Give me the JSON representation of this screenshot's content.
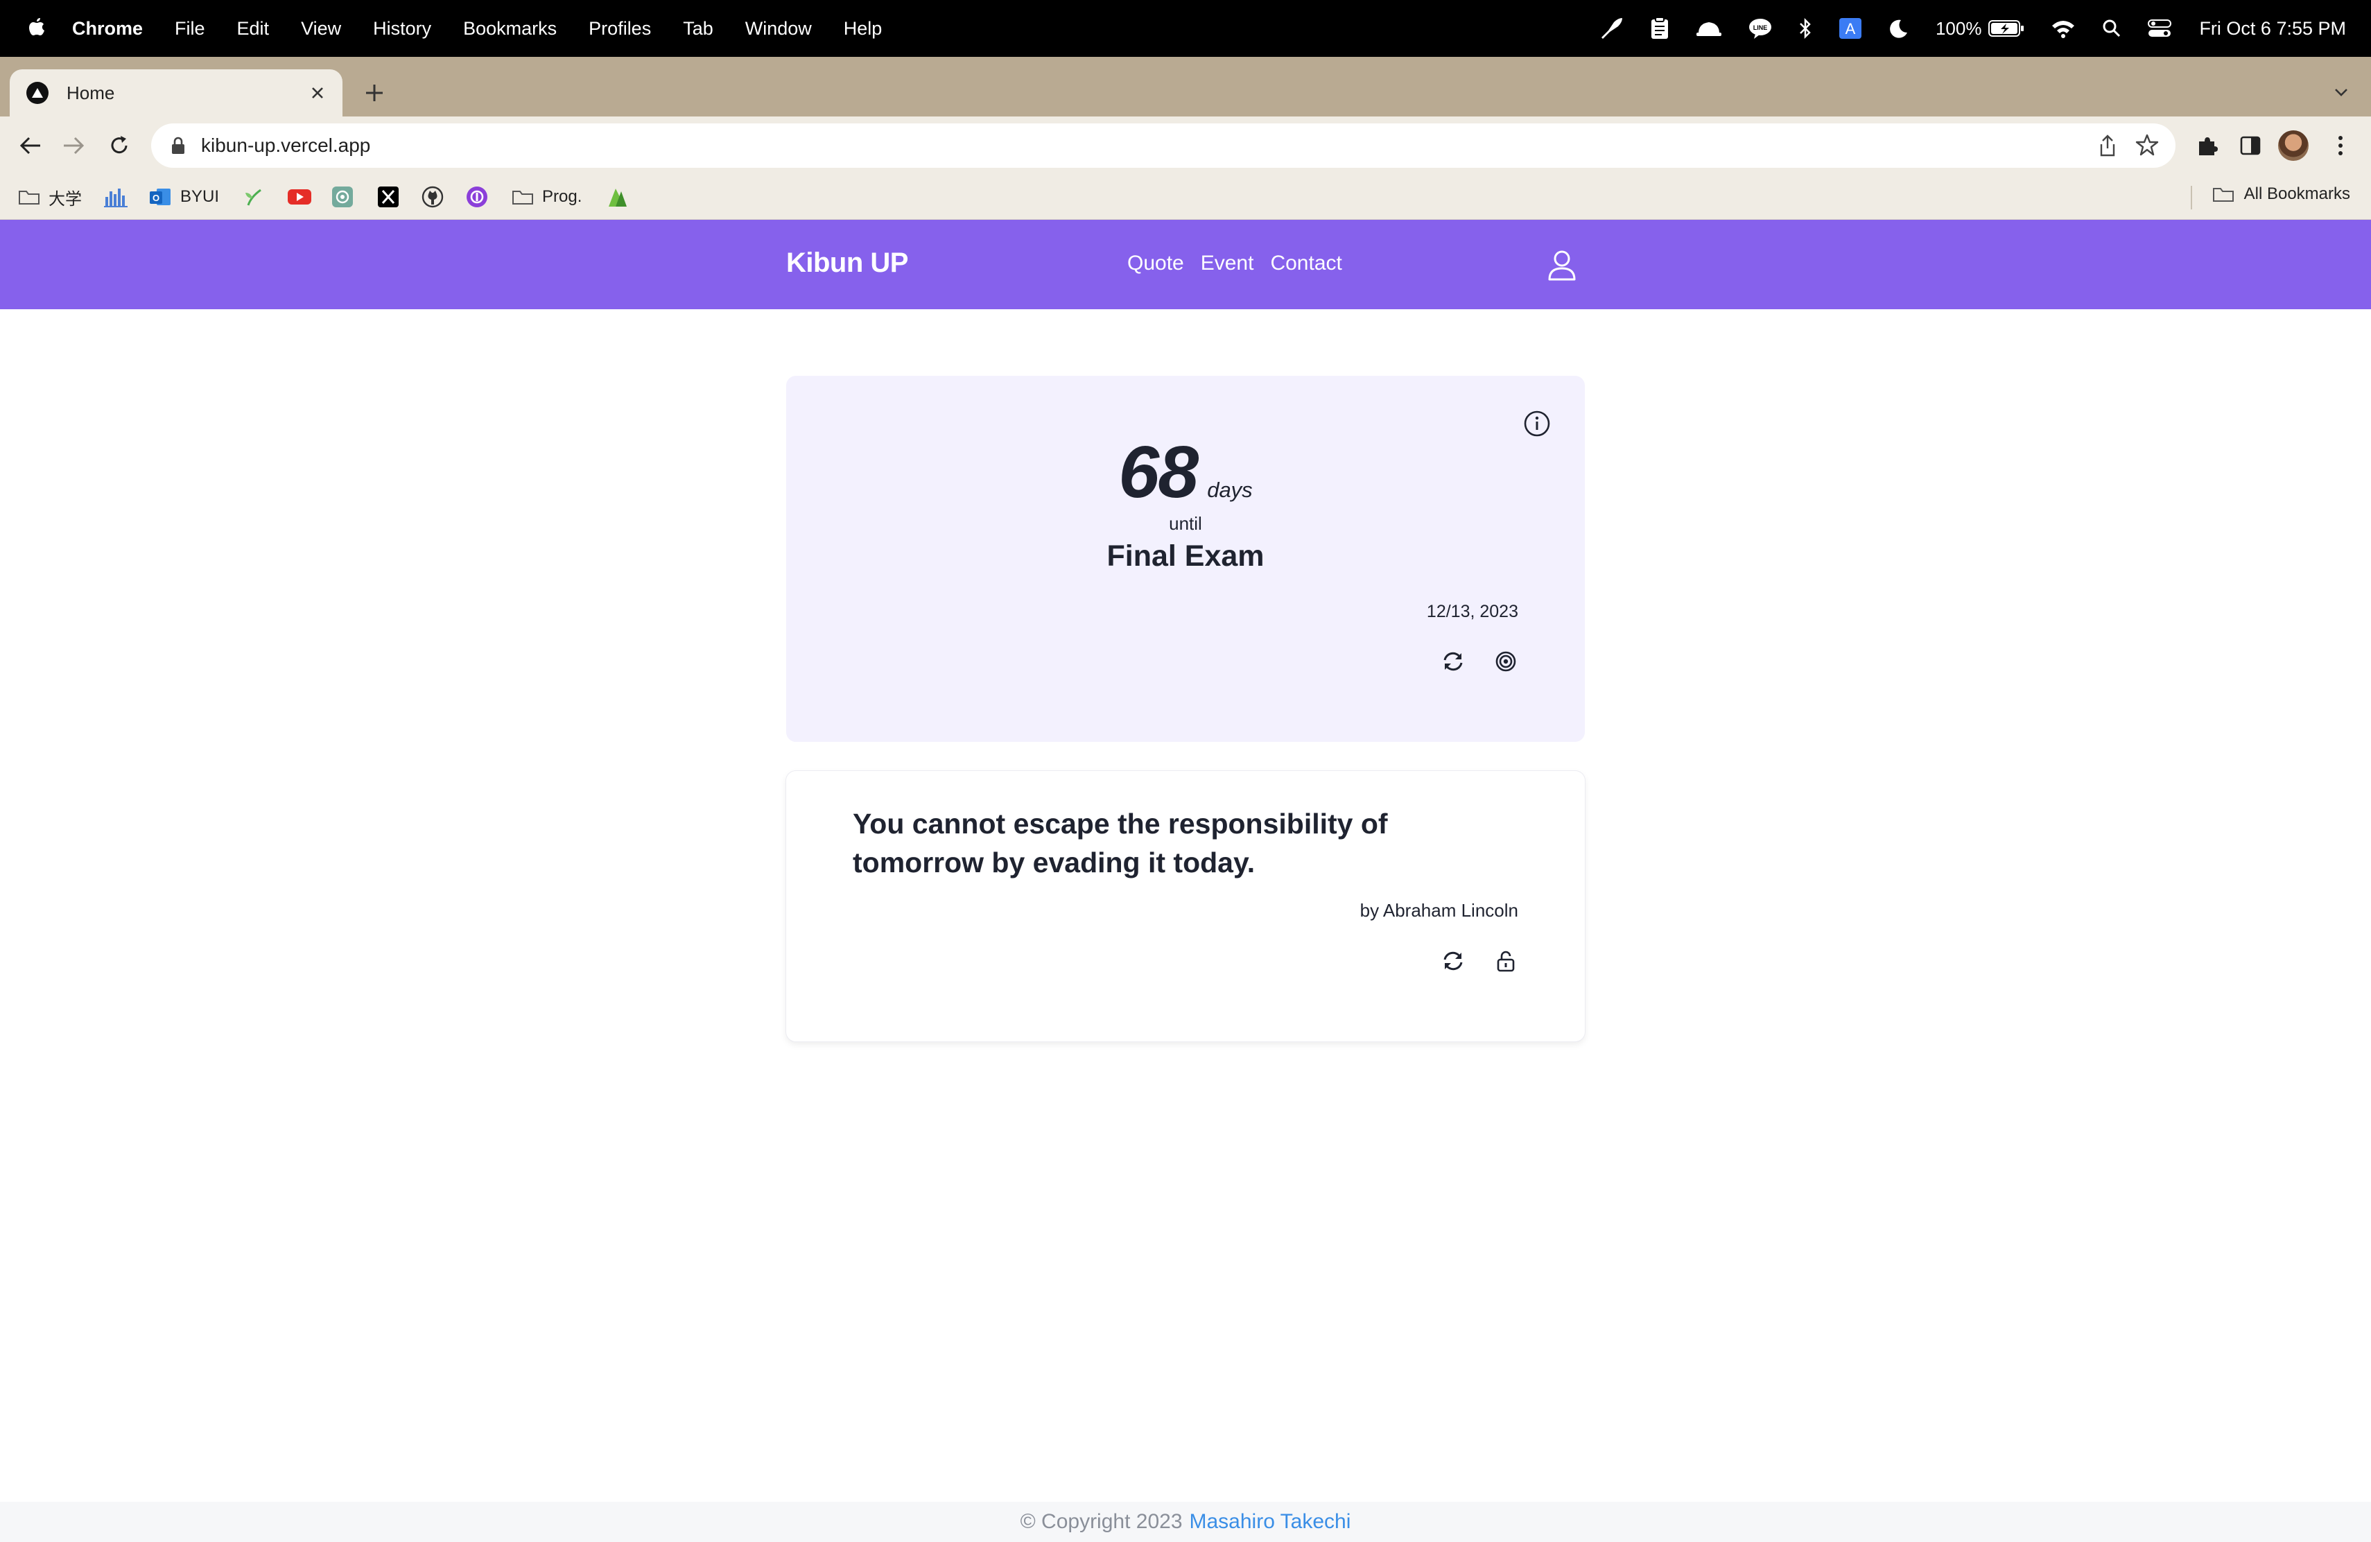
{
  "menubar": {
    "app": "Chrome",
    "items": [
      "File",
      "Edit",
      "View",
      "History",
      "Bookmarks",
      "Profiles",
      "Tab",
      "Window",
      "Help"
    ],
    "battery": "100%",
    "clock": "Fri Oct 6  7:55 PM"
  },
  "browser": {
    "tab_title": "Home",
    "url": "kibun-up.vercel.app",
    "bookmarks": [
      {
        "label": "大学",
        "icon": "folder-icon"
      },
      {
        "label": "",
        "icon": "bar-chart-icon"
      },
      {
        "label": "BYUI",
        "icon": "outlook-icon"
      },
      {
        "label": "",
        "icon": "sprout-icon"
      },
      {
        "label": "",
        "icon": "youtube-icon"
      },
      {
        "label": "",
        "icon": "openai-icon"
      },
      {
        "label": "",
        "icon": "x-icon"
      },
      {
        "label": "",
        "icon": "github-icon"
      },
      {
        "label": "",
        "icon": "purple-circle-icon"
      },
      {
        "label": "Prog.",
        "icon": "folder-icon"
      },
      {
        "label": "",
        "icon": "leaf-icon"
      }
    ],
    "all_bookmarks": "All Bookmarks"
  },
  "site": {
    "brand": "Kibun UP",
    "nav": [
      "Quote",
      "Event",
      "Contact"
    ],
    "accent": "#8661ec"
  },
  "event_card": {
    "days": "68",
    "days_unit": "days",
    "until": "until",
    "event_name": "Final Exam",
    "date": "12/13, 2023"
  },
  "quote_card": {
    "text": "You cannot escape the responsibility of tomorrow by evading it today.",
    "author": "by Abraham Lincoln"
  },
  "footer": {
    "copyright": "© Copyright 2023",
    "author": "Masahiro Takechi",
    "author_color": "#3a8ee6"
  }
}
